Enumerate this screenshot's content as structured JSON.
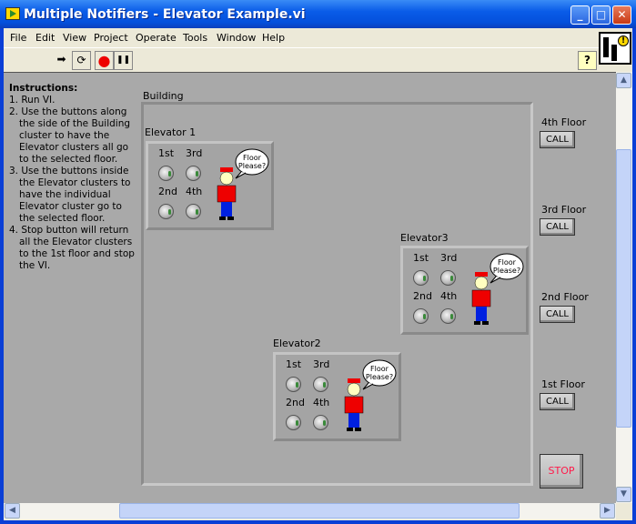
{
  "window": {
    "title": "Multiple Notifiers - Elevator Example.vi"
  },
  "menu": [
    "File",
    "Edit",
    "View",
    "Project",
    "Operate",
    "Tools",
    "Window",
    "Help"
  ],
  "toolbar": {
    "run": "➡",
    "run_continuous": "⟳",
    "abort": "●",
    "pause": "❚❚",
    "help": "?"
  },
  "instructions": {
    "heading": "Instructions:",
    "steps": [
      "1. Run VI.",
      "2. Use the buttons along the side of the Building cluster to have the Elevator clusters all go to the selected floor.",
      "3. Use the buttons inside the Elevator clusters to have the individual Elevator cluster go to the selected floor.",
      "4. Stop button will return all the Elevator clusters to the 1st floor and stop the VI."
    ]
  },
  "building": {
    "label": "Building",
    "elevators": [
      {
        "label": "Elevator 1"
      },
      {
        "label": "Elevator2"
      },
      {
        "label": "Elevator3"
      }
    ],
    "floor_buttons": {
      "first": "1st",
      "third": "3rd",
      "second": "2nd",
      "fourth": "4th"
    },
    "bubble": "Floor Please?"
  },
  "floors": [
    {
      "label": "4th Floor",
      "button": "CALL"
    },
    {
      "label": "3rd Floor",
      "button": "CALL"
    },
    {
      "label": "2nd Floor",
      "button": "CALL"
    },
    {
      "label": "1st Floor",
      "button": "CALL"
    }
  ],
  "stop_button": "STOP"
}
